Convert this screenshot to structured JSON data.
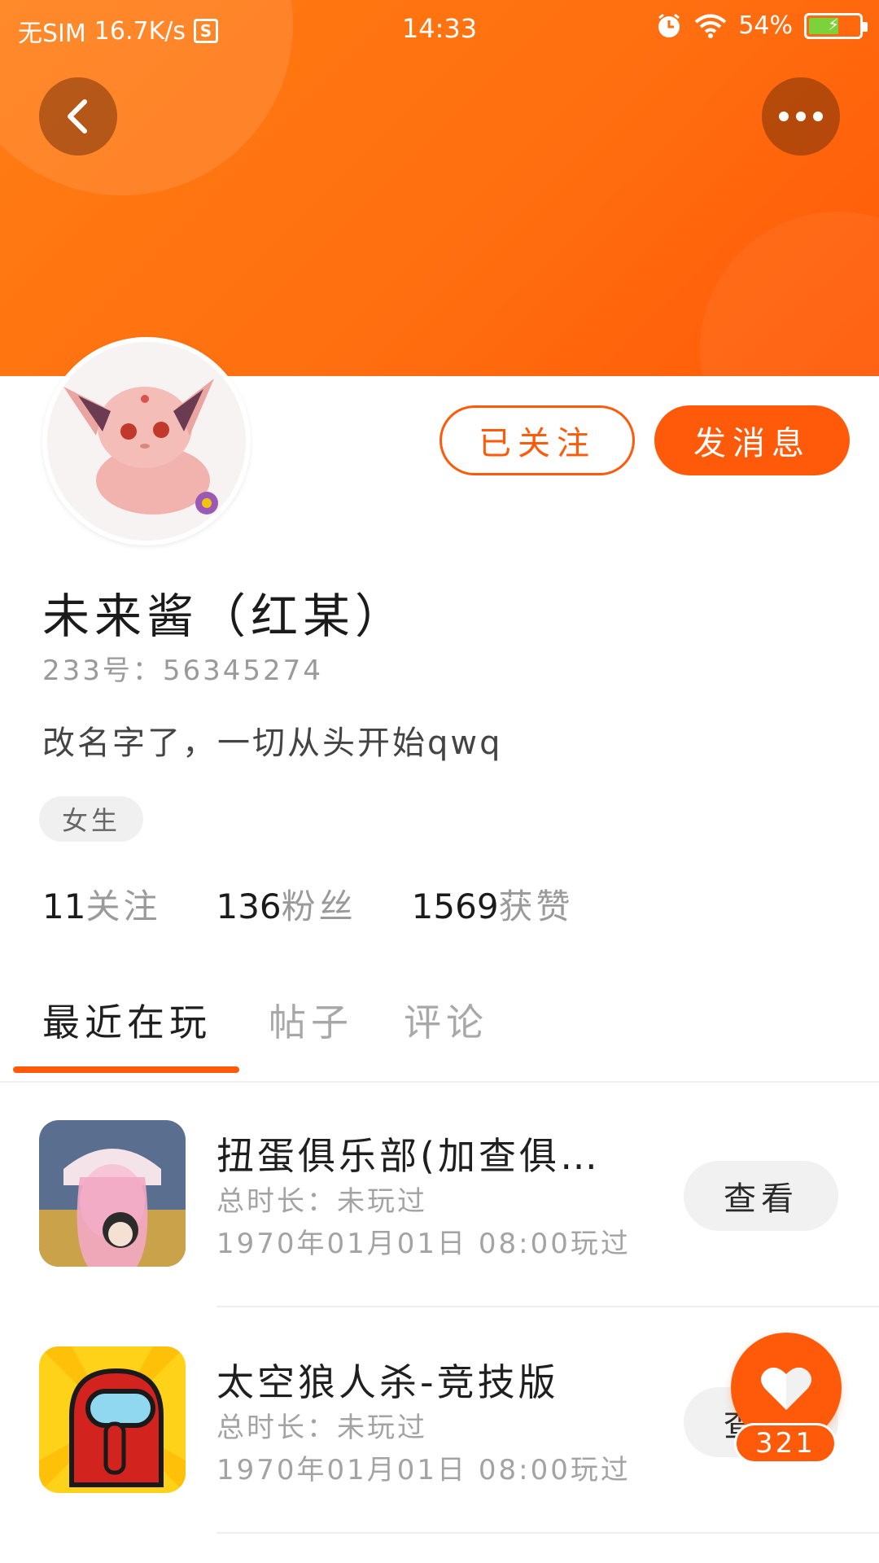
{
  "status_bar": {
    "carrier": "无SIM",
    "net_speed": "16.7K/s",
    "s_badge": "S",
    "time": "14:33",
    "battery": "54%",
    "icons": [
      "alarm-icon",
      "wifi-icon",
      "battery-icon"
    ]
  },
  "header": {
    "back_icon": "chevron-left-icon",
    "more_icon": "more-dots-icon",
    "gradient_colors": [
      "#ff7d12",
      "#ff5a08"
    ]
  },
  "profile": {
    "follow_label": "已关注",
    "message_label": "发消息",
    "name": "未来酱（红某）",
    "id_line": "233号：56345274",
    "bio": "改名字了，一切从头开始qwq",
    "tag": "女生",
    "stats": [
      {
        "num": "11",
        "label": "关注"
      },
      {
        "num": "136",
        "label": "粉丝"
      },
      {
        "num": "1569",
        "label": "获赞"
      }
    ]
  },
  "tabs": [
    {
      "label": "最近在玩",
      "active": true
    },
    {
      "label": "帖子",
      "active": false
    },
    {
      "label": "评论",
      "active": false
    }
  ],
  "games": [
    {
      "title": "扭蛋俱乐部(加查俱…",
      "duration": "总时长：未玩过",
      "last_played": "1970年01月01日 08:00玩过",
      "button": "查看"
    },
    {
      "title": "太空狼人杀-竞技版",
      "duration": "总时长：未玩过",
      "last_played": "1970年01月01日 08:00玩过",
      "button": "查看"
    }
  ],
  "like": {
    "count": "321"
  },
  "colors": {
    "accent": "#ff5a0a"
  }
}
